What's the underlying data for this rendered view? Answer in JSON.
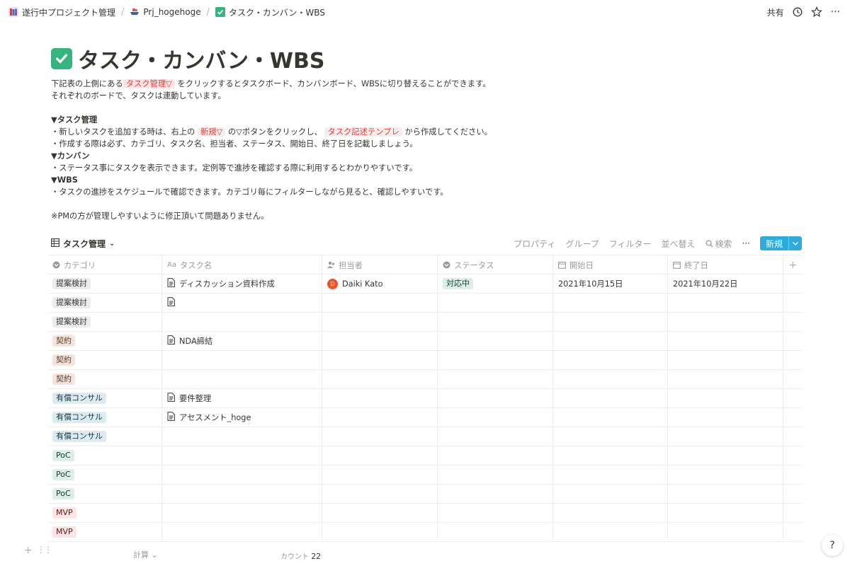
{
  "breadcrumb": [
    {
      "label": "遂行中プロジェクト管理",
      "icon": "books-icon"
    },
    {
      "label": "Prj_hogehoge",
      "icon": "ship-icon"
    },
    {
      "label": "タスク・カンバン・WBS",
      "icon": "check-icon"
    }
  ],
  "topbar": {
    "share_label": "共有"
  },
  "page": {
    "title": "タスク・カンバン・WBS",
    "intro_1a": "下記表の上側にある",
    "intro_tag": "タスク管理▽",
    "intro_1b": "をクリックするとタスクボード、カンバンボード、WBSに切り替えることができます。",
    "intro_2": "それぞれのボードで、タスクは連動しています。",
    "h_task": "▼タスク管理",
    "task_1a": "・新しいタスクを追加する時は、右上の",
    "task_tag1": "新規▽",
    "task_1b": "の▽ボタンをクリックし、",
    "task_tag2": "タスク記述テンプレ",
    "task_1c": "から作成してください。",
    "task_2": "・作成する際は必ず、カテゴリ、タスク名、担当者、ステータス、開始日、終了日を記載しましょう。",
    "h_kanban": "▼カンバン",
    "kanban_1": "・ステータス事にタスクを表示できます。定例等で進捗を確認する際に利用するとわかりやすいです。",
    "h_wbs": "▼WBS",
    "wbs_1": "・タスクの進捗をスケジュールで確認できます。カテゴリ毎にフィルターしながら見ると、確認しやすいです。",
    "note": "※PMの方が管理しやすいように修正頂いて問題ありません。"
  },
  "view": {
    "name": "タスク管理",
    "actions": {
      "property": "プロパティ",
      "group": "グループ",
      "filter": "フィルター",
      "sort": "並べ替え",
      "search": "検索"
    },
    "new_label": "新規"
  },
  "columns": [
    "カテゴリ",
    "タスク名",
    "担当者",
    "ステータス",
    "開始日",
    "終了日"
  ],
  "rows": [
    {
      "category": "提案検討",
      "task": "ディスカッション資料作成",
      "assignee": "Daiki Kato",
      "avatar": "D",
      "status": "対応中",
      "start": "2021年10月15日",
      "end": "2021年10月22日"
    },
    {
      "category": "提案検討",
      "task": "",
      "assignee": "",
      "status": "",
      "start": "",
      "end": ""
    },
    {
      "category": "提案検討",
      "task": "",
      "assignee": "",
      "status": "",
      "start": "",
      "end": ""
    },
    {
      "category": "契約",
      "task": "NDA締結",
      "assignee": "",
      "status": "",
      "start": "",
      "end": ""
    },
    {
      "category": "契約",
      "task": "",
      "assignee": "",
      "status": "",
      "start": "",
      "end": ""
    },
    {
      "category": "契約",
      "task": "",
      "assignee": "",
      "status": "",
      "start": "",
      "end": ""
    },
    {
      "category": "有償コンサル",
      "task": "要件整理",
      "assignee": "",
      "status": "",
      "start": "",
      "end": ""
    },
    {
      "category": "有償コンサル",
      "task": "アセスメント_hoge",
      "assignee": "",
      "status": "",
      "start": "",
      "end": ""
    },
    {
      "category": "有償コンサル",
      "task": "",
      "assignee": "",
      "status": "",
      "start": "",
      "end": ""
    },
    {
      "category": "PoC",
      "task": "",
      "assignee": "",
      "status": "",
      "start": "",
      "end": ""
    },
    {
      "category": "PoC",
      "task": "",
      "assignee": "",
      "status": "",
      "start": "",
      "end": ""
    },
    {
      "category": "PoC",
      "task": "",
      "assignee": "",
      "status": "",
      "start": "",
      "end": ""
    },
    {
      "category": "MVP",
      "task": "",
      "assignee": "",
      "status": "",
      "start": "",
      "end": ""
    },
    {
      "category": "MVP",
      "task": "",
      "assignee": "",
      "status": "",
      "start": "",
      "end": ""
    }
  ],
  "category_colors": {
    "提案検討": {
      "bg": "#ebeced",
      "fg": "#37352f"
    },
    "契約": {
      "bg": "#f4e4dd",
      "fg": "#5a3b2e"
    },
    "有償コンサル": {
      "bg": "#ddebf1",
      "fg": "#183347"
    },
    "PoC": {
      "bg": "#ddedea",
      "fg": "#1c3829"
    },
    "MVP": {
      "bg": "#fbe4e4",
      "fg": "#5d1715"
    }
  },
  "status_color": {
    "bg": "#ddedea",
    "fg": "#1c3829"
  },
  "footer": {
    "calc_label": "計算",
    "count_label": "カウント",
    "count_value": "22"
  }
}
